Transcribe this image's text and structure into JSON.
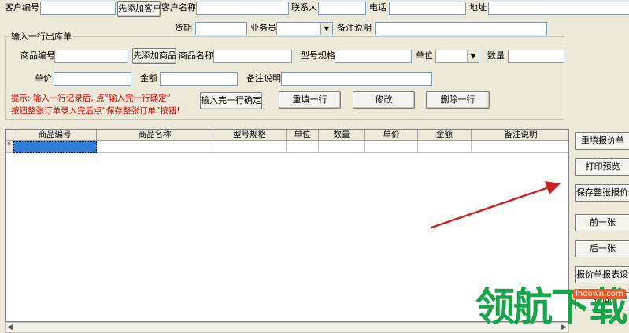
{
  "customer": {
    "code_label": "客户编号",
    "add_customer_button": "先添加客户",
    "name_label": "客户名称",
    "contact_label": "联系人",
    "phone_label": "电话",
    "address_label": "地址",
    "term_label": "货期",
    "salesman_label": "业务员",
    "remark_label": "备注说明"
  },
  "line_entry": {
    "group_title": "输入一行出库单",
    "product_code_label": "商品编号",
    "add_product_button": "先添加商品",
    "product_name_label": "商品名称",
    "model_label": "型号规格",
    "unit_label": "单位",
    "quantity_label": "数量",
    "price_label": "单价",
    "amount_label": "金额",
    "remark_label": "备注说明",
    "hint_line1": "提示: 输入一行记录后, 点“输入完一行确定”",
    "hint_line2": "按钮整张订单录入完后点“保存整张订单”按钮!",
    "confirm_button": "输入完一行确定",
    "refill_button": "重填一行",
    "modify_button": "修改",
    "delete_button": "删除一行"
  },
  "grid": {
    "columns": [
      "商品编号",
      "商品名称",
      "型号规格",
      "单位",
      "数量",
      "单价",
      "金额",
      "备注说明"
    ],
    "new_row_marker": "*"
  },
  "side_buttons": {
    "refill_quote": "重填报价单",
    "print_preview": "打印预览",
    "save_quote": "保存整张报价单",
    "prev": "前一张",
    "next": "后一张",
    "report_design": "报价单报表设计",
    "back": "返回"
  },
  "watermark": {
    "text": "领航下载",
    "url": "lhdown.com"
  },
  "colors": {
    "background": "#ece9d8",
    "hint_text": "#d40000",
    "arrow": "#cc2020",
    "watermark": "#1aa34a"
  }
}
